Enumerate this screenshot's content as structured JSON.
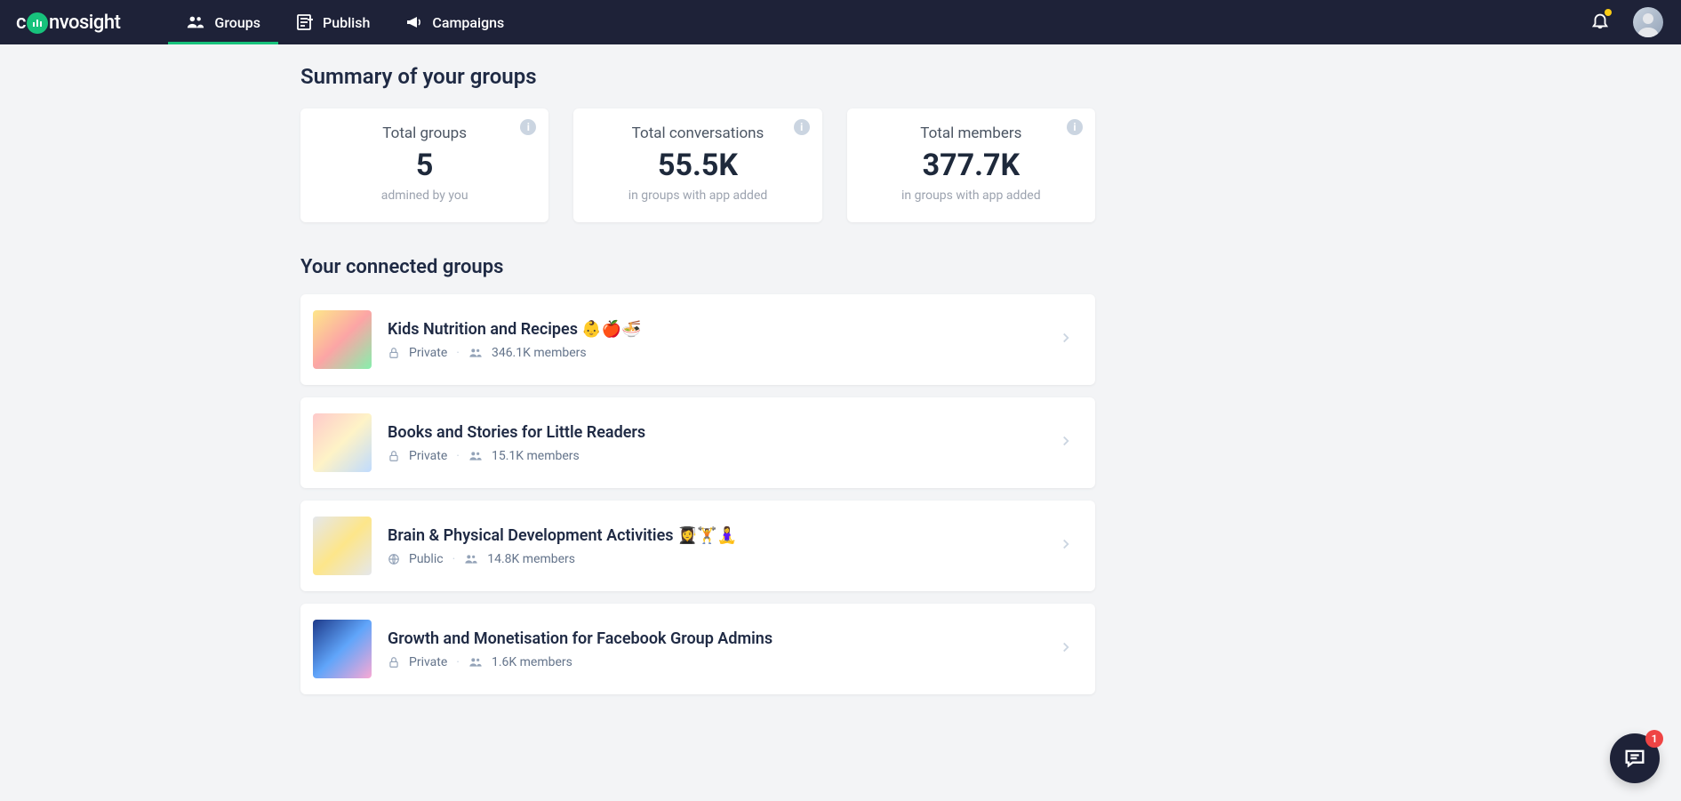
{
  "brand": {
    "pre": "c",
    "post": "nvosight"
  },
  "nav": {
    "items": [
      {
        "label": "Groups",
        "active": true
      },
      {
        "label": "Publish",
        "active": false
      },
      {
        "label": "Campaigns",
        "active": false
      }
    ]
  },
  "summary": {
    "title": "Summary of your groups",
    "cards": [
      {
        "label": "Total groups",
        "value": "5",
        "sub": "admined by you"
      },
      {
        "label": "Total conversations",
        "value": "55.5K",
        "sub": "in groups with app added"
      },
      {
        "label": "Total members",
        "value": "377.7K",
        "sub": "in groups with app added"
      }
    ]
  },
  "connected": {
    "title": "Your connected groups",
    "groups": [
      {
        "name": "Kids Nutrition and Recipes 👶🍎🍜",
        "privacy": "Private",
        "members": "346.1K members",
        "thumb": "linear-gradient(135deg,#fde68a,#fca5a5,#86efac)"
      },
      {
        "name": "Books and Stories for Little Readers",
        "privacy": "Private",
        "members": "15.1K members",
        "thumb": "linear-gradient(135deg,#fecaca,#fef3c7,#bfdbfe)"
      },
      {
        "name": "Brain & Physical Development Activities 👩‍🎓🏋🧘‍♀️",
        "privacy": "Public",
        "members": "14.8K members",
        "thumb": "linear-gradient(135deg,#e5e7eb,#fde68a,#e5e7eb)"
      },
      {
        "name": "Growth and Monetisation for Facebook Group Admins",
        "privacy": "Private",
        "members": "1.6K members",
        "thumb": "linear-gradient(135deg,#1e3a8a,#60a5fa,#f9a8d4)"
      }
    ]
  },
  "chat": {
    "badge": "1"
  }
}
